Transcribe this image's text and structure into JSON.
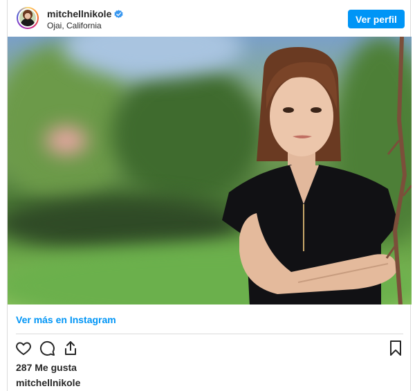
{
  "post": {
    "username": "mitchellnikole",
    "location": "Ojai, California",
    "profile_button": "Ver perfil",
    "see_more": "Ver más en Instagram",
    "likes": "287 Me gusta",
    "caption_username": "mitchellnikole"
  },
  "colors": {
    "accent": "#0095f6",
    "text": "#262626",
    "divider": "#dbdbdb"
  },
  "icons": {
    "like": "heart-icon",
    "comment": "comment-icon",
    "share": "share-icon",
    "save": "bookmark-icon",
    "verified": "verified-badge-icon"
  }
}
